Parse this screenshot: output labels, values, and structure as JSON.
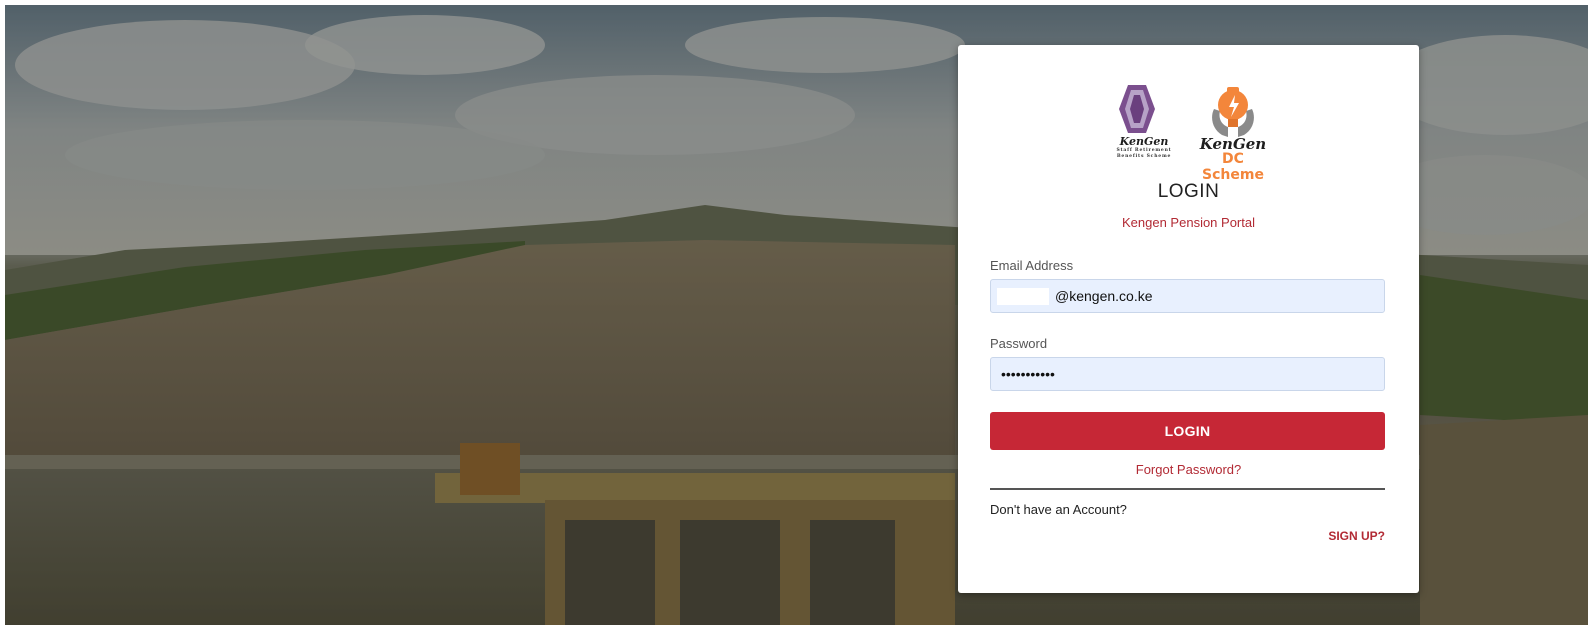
{
  "login": {
    "logos": {
      "srbs": {
        "brand": "KenGen",
        "sub_line1": "Staff Retirement",
        "sub_line2": "Benefits Scheme"
      },
      "dc": {
        "brand": "KenGen",
        "sub": "DC Scheme"
      }
    },
    "title": "LOGIN",
    "subtitle": "Kengen Pension Portal",
    "email_label": "Email Address",
    "email_value": "@kengen.co.ke",
    "password_label": "Password",
    "password_value": "•••••••••••",
    "login_button": "LOGIN",
    "forgot_password": "Forgot Password?",
    "no_account_text": "Don't have an Account?",
    "signup_link": "SIGN UP?"
  },
  "colors": {
    "accent": "#c62736",
    "link": "#b22a34",
    "input_bg": "#e8f0fe",
    "dc_orange": "#f3863b",
    "srbs_purple": "#7b4f8e"
  }
}
